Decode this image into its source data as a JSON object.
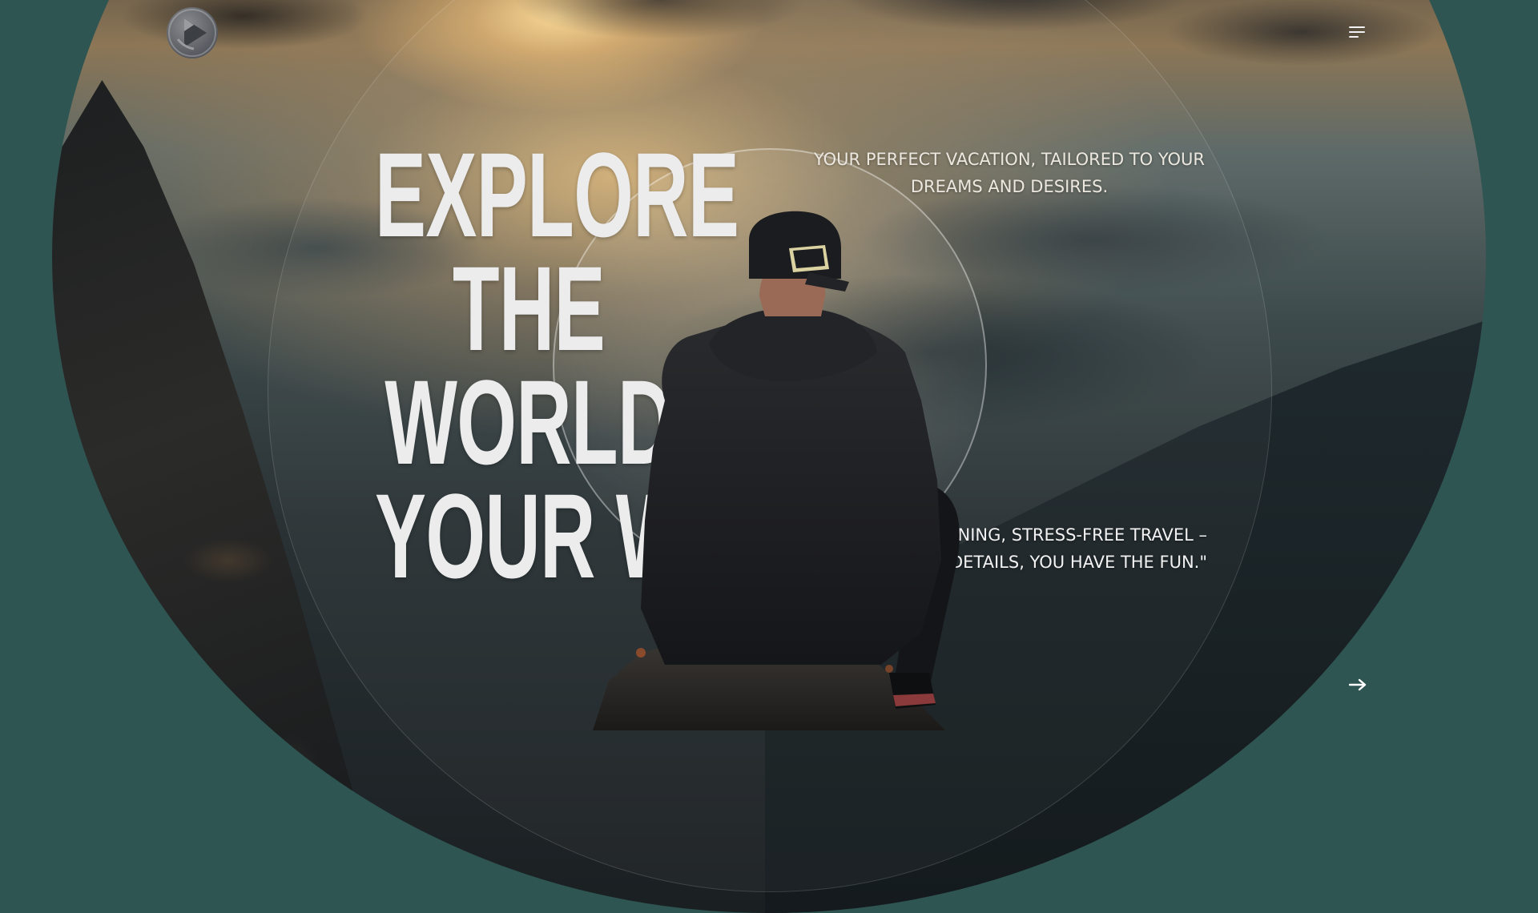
{
  "brand": {
    "logo_icon": "aperture-logo-icon"
  },
  "header": {
    "menu_icon": "hamburger-menu-icon"
  },
  "hero": {
    "headline_lines": [
      "EXPLORE",
      "THE",
      "WORLD",
      "YOUR WA"
    ],
    "tagline": "YOUR PERFECT VACATION, TAILORED TO YOUR DREAMS AND DESIRES.",
    "quote_lines": [
      "NING, STRESS-FREE TRAVEL –",
      "DETAILS, YOU HAVE THE FUN.\""
    ]
  },
  "nav": {
    "next_icon": "arrow-right-icon"
  },
  "colors": {
    "background": "#2e5552",
    "text_light": "#ececec",
    "accent_warm": "#d6b278"
  }
}
